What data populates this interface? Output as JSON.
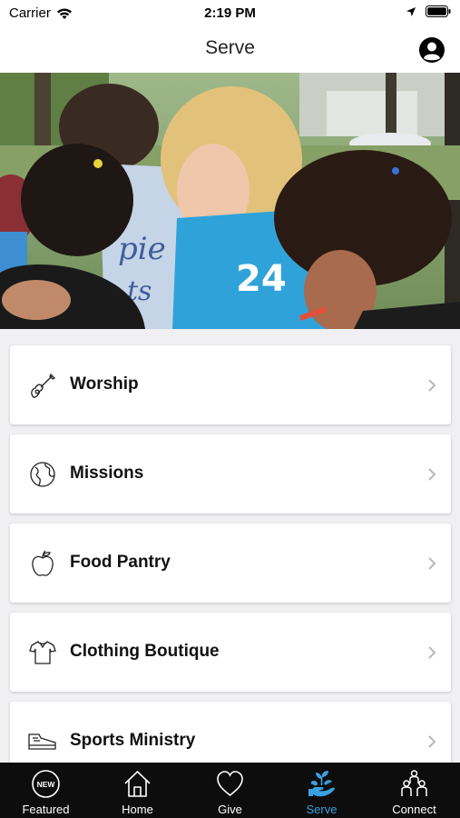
{
  "status": {
    "carrier": "Carrier",
    "time": "2:19 PM"
  },
  "nav": {
    "title": "Serve"
  },
  "items": [
    {
      "label": "Worship",
      "icon": "guitar-icon"
    },
    {
      "label": "Missions",
      "icon": "globe-icon"
    },
    {
      "label": "Food Pantry",
      "icon": "apple-icon"
    },
    {
      "label": "Clothing Boutique",
      "icon": "shirt-icon"
    },
    {
      "label": "Sports Ministry",
      "icon": "sneaker-icon"
    }
  ],
  "tabs": [
    {
      "label": "Featured",
      "icon": "new-badge-icon",
      "active": false
    },
    {
      "label": "Home",
      "icon": "house-icon",
      "active": false
    },
    {
      "label": "Give",
      "icon": "heart-icon",
      "active": false
    },
    {
      "label": "Serve",
      "icon": "hand-plant-icon",
      "active": true
    },
    {
      "label": "Connect",
      "icon": "people-icon",
      "active": false
    }
  ],
  "badge_text": "NEW",
  "colors": {
    "accent": "#3aa0e0",
    "tab_bg": "#0d0d0d",
    "list_bg": "#f0f0f2"
  }
}
